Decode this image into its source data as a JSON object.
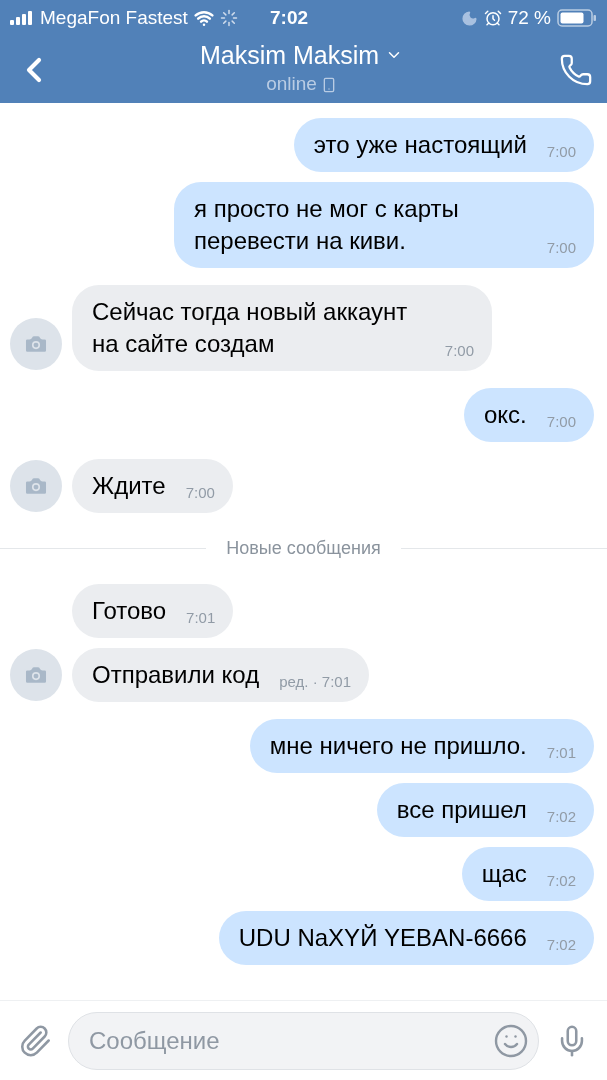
{
  "status_bar": {
    "carrier": "MegaFon Fastest",
    "time": "7:02",
    "battery": "72 %"
  },
  "header": {
    "title": "Maksim Maksim",
    "subtitle": "online"
  },
  "messages": [
    {
      "kind": "out",
      "text": "это уже настоящий",
      "time": "7:00"
    },
    {
      "kind": "out",
      "text": "я просто не мог с карты перевести на киви.",
      "time": "7:00"
    },
    {
      "kind": "in",
      "text": "Сейчас тогда новый аккаунт на сайте создам",
      "time": "7:00",
      "avatar": true
    },
    {
      "kind": "out",
      "text": "окс.",
      "time": "7:00"
    },
    {
      "kind": "in",
      "text": "Ждите",
      "time": "7:00",
      "avatar": true
    },
    {
      "kind": "divider",
      "text": "Новые сообщения"
    },
    {
      "kind": "in",
      "text": "Готово",
      "time": "7:01",
      "avatar": false
    },
    {
      "kind": "in",
      "text": "Отправили код",
      "time": "ред. · 7:01",
      "avatar": true
    },
    {
      "kind": "out",
      "text": "мне ничего не пришло.",
      "time": "7:01"
    },
    {
      "kind": "out",
      "text": "все пришел",
      "time": "7:02"
    },
    {
      "kind": "out",
      "text": "щас",
      "time": "7:02"
    },
    {
      "kind": "out",
      "text": "UDU NaXYЙ YEBAN-6666",
      "time": "7:02"
    }
  ],
  "composer": {
    "placeholder": "Сообщение"
  }
}
